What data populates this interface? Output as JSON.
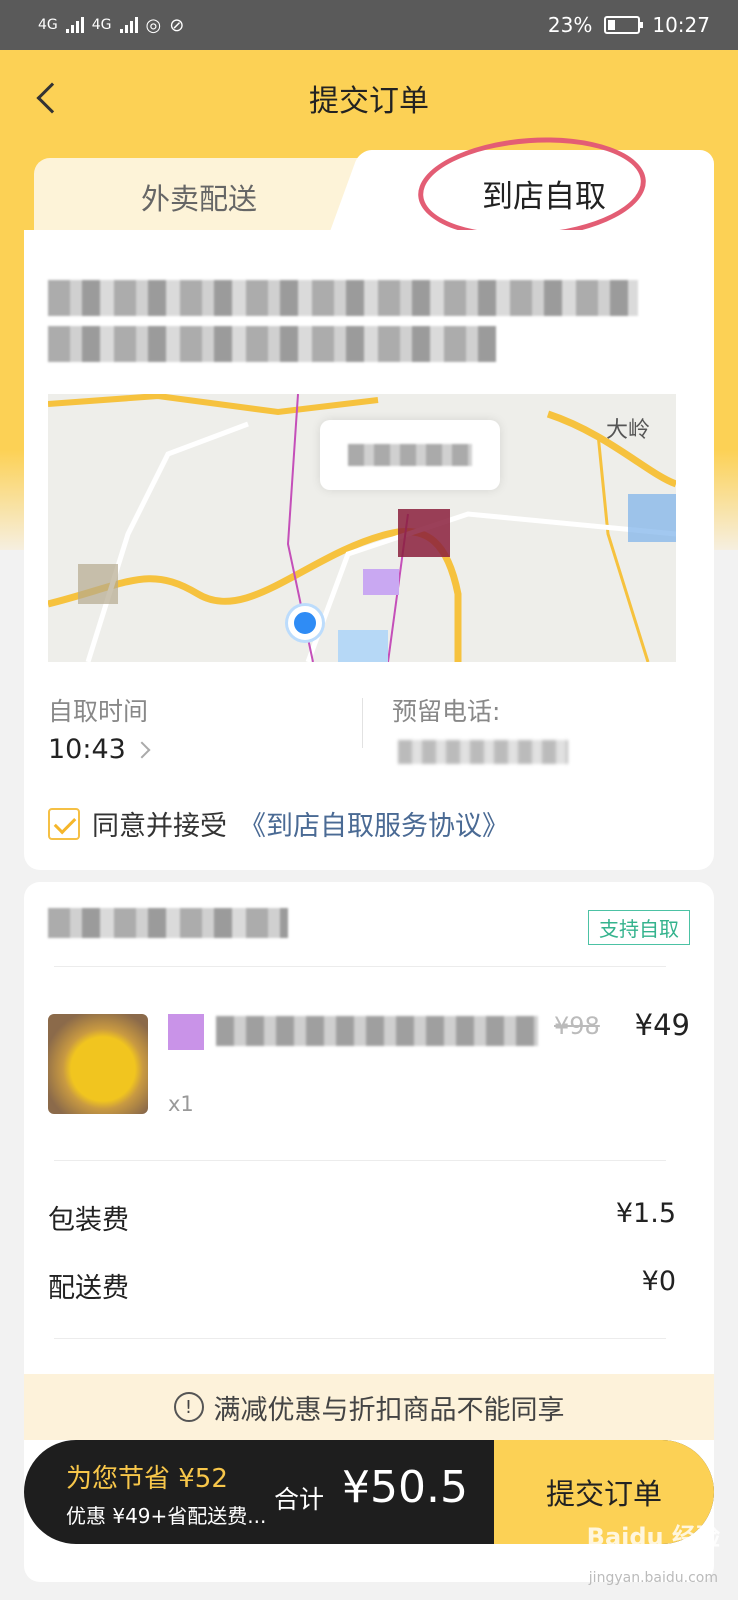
{
  "status_bar": {
    "network": "4G",
    "battery": "23%",
    "time": "10:27"
  },
  "nav": {
    "title": "提交订单"
  },
  "tabs": {
    "delivery": "外卖配送",
    "pickup": "到店自取"
  },
  "map": {
    "place_label": "大岭"
  },
  "pickup": {
    "time_label": "自取时间",
    "time_value": "10:43",
    "phone_label": "预留电话:"
  },
  "agreement": {
    "text": "同意并接受",
    "link": "《到店自取服务协议》"
  },
  "order": {
    "badge": "支持自取",
    "item": {
      "original_price": "¥98",
      "price": "¥49",
      "quantity": "x1"
    },
    "fees": [
      {
        "label": "包装费",
        "value": "¥1.5"
      },
      {
        "label": "配送费",
        "value": "¥0"
      }
    ]
  },
  "notice": {
    "icon": "exclamation-circle-icon",
    "text": "满减优惠与折扣商品不能同享"
  },
  "bottom_bar": {
    "save_text": "为您节省 ¥52",
    "save_detail": "优惠 ¥49+省配送费...",
    "total_label": "合计",
    "total_value": "¥50.5",
    "submit_label": "提交订单"
  },
  "watermark": {
    "text": "Baidu 经验",
    "sub": "jingyan.baidu.com"
  },
  "colors": {
    "brand_yellow": "#fcd155",
    "link_blue": "#4a6a94",
    "badge_green": "#34b38d",
    "annotation_red": "#e35d74"
  }
}
